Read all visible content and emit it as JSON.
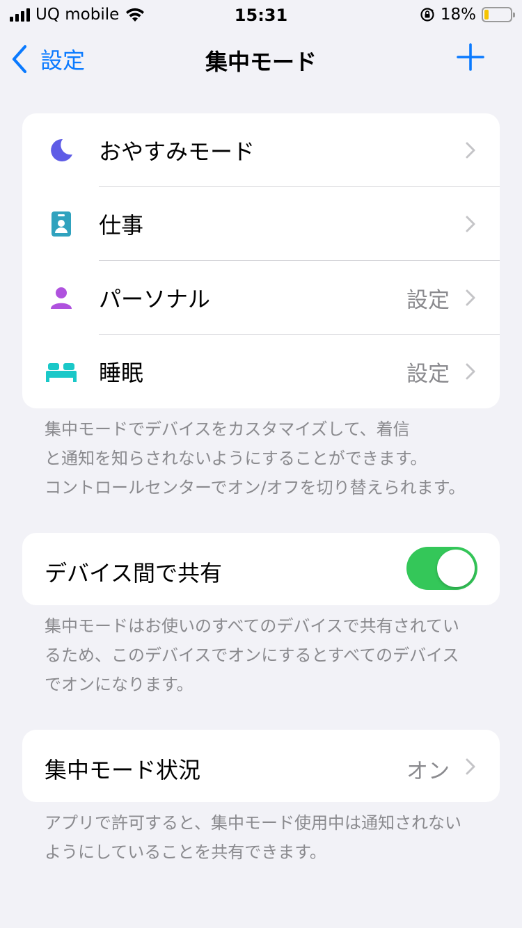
{
  "status": {
    "carrier": "UQ mobile",
    "time": "15:31",
    "battery": "18%",
    "battery_level": 0.18
  },
  "nav": {
    "back_label": "設定",
    "title": "集中モード"
  },
  "focus_modes": [
    {
      "label": "おやすみモード",
      "value": "",
      "icon": "moon-icon",
      "color": "#5e5ce6"
    },
    {
      "label": "仕事",
      "value": "",
      "icon": "id-badge-icon",
      "color": "#30a2be"
    },
    {
      "label": "パーソナル",
      "value": "設定",
      "icon": "person-icon",
      "color": "#af52de"
    },
    {
      "label": "睡眠",
      "value": "設定",
      "icon": "bed-icon",
      "color": "#1ac8c8"
    }
  ],
  "focus_footer": [
    "集中モードでデバイスをカスタマイズして、着信",
    "と通知を知らされないようにすることができます。",
    "コントロールセンターでオン/オフを切り替えられます。"
  ],
  "share": {
    "label": "デバイス間で共有",
    "enabled": true,
    "footer": [
      "集中モードはお使いのすべてのデバイスで共有されてい",
      "るため、このデバイスでオンにするとすべてのデバイス",
      "でオンになります。"
    ]
  },
  "focus_status": {
    "label": "集中モード状況",
    "value": "オン",
    "footer": [
      "アプリで許可すると、集中モード使用中は通知されない",
      "ようにしていることを共有できます。"
    ]
  },
  "colors": {
    "accent": "#0a7aff",
    "toggle_on": "#34c759",
    "background": "#f2f2f7"
  }
}
